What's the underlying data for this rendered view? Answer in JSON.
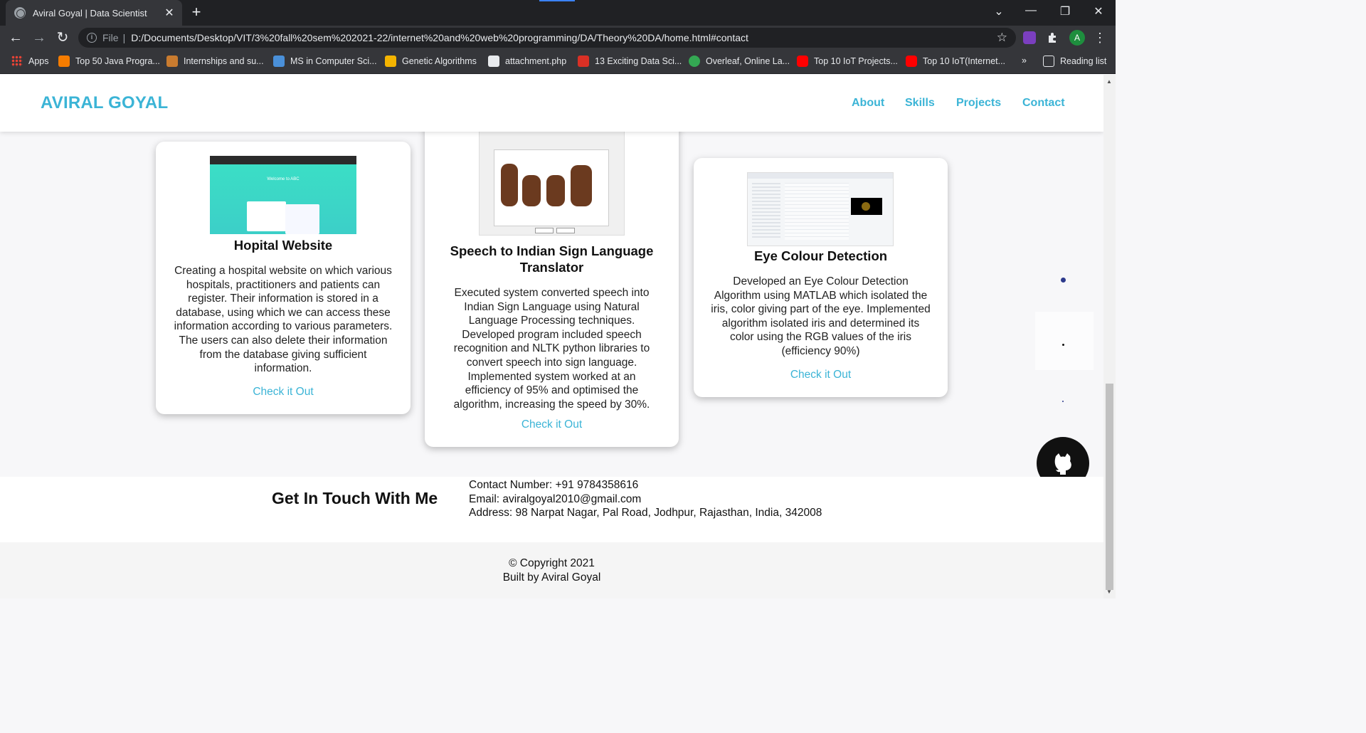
{
  "browser": {
    "tab_title": "Aviral Goyal | Data Scientist",
    "tab_close": "✕",
    "new_tab": "+",
    "url_scheme": "File",
    "url_separator": "|",
    "url": "D:/Documents/Desktop/VIT/3%20fall%20sem%202021-22/internet%20and%20web%20programming/DA/Theory%20DA/home.html#contact",
    "profile_initial": "A",
    "window_controls": {
      "tab_search": "⌄",
      "minimize": "—",
      "restore": "❐",
      "close": "✕"
    },
    "nav": {
      "back": "←",
      "forward": "→",
      "reload": "↻",
      "star": "☆",
      "menu": "⋮"
    }
  },
  "bookmarks": {
    "items": [
      {
        "label": "Apps",
        "icon": "apps-grid-icon",
        "color": "#ea4335"
      },
      {
        "label": "Top 50 Java Progra...",
        "icon": "blogger-icon",
        "color": "#f57c00"
      },
      {
        "label": "Internships and su...",
        "icon": "building-icon",
        "color": "#c97b2f"
      },
      {
        "label": "MS in Computer Sci...",
        "icon": "shield-icon",
        "color": "#4a90d9"
      },
      {
        "label": "Genetic Algorithms",
        "icon": "puzzle-icon",
        "color": "#f4b400"
      },
      {
        "label": "attachment.php",
        "icon": "vtop-icon",
        "color": "#e8eaed"
      },
      {
        "label": "13 Exciting Data Sci...",
        "icon": "analytics-icon",
        "color": "#d93025"
      },
      {
        "label": "Overleaf, Online La...",
        "icon": "leaf-icon",
        "color": "#34a853"
      },
      {
        "label": "Top 10 IoT Projects...",
        "icon": "youtube-icon",
        "color": "#ff0000"
      },
      {
        "label": "Top 10 IoT(Internet...",
        "icon": "youtube-icon",
        "color": "#ff0000"
      }
    ],
    "overflow": "»",
    "reading_list": "Reading list"
  },
  "site": {
    "brand": "AVIRAL GOYAL",
    "nav": [
      "About",
      "Skills",
      "Projects",
      "Contact"
    ],
    "accent_color": "#3bb4d6"
  },
  "projects": [
    {
      "title": "Hopital Website",
      "description": "Creating a hospital website on which various hospitals, practitioners and patients can register. Their information is stored in a database, using which we can access these information according to various parameters. The users can also delete their information from the database giving sufficient information.",
      "link": "Check it Out",
      "image_text": "Welcome to ABC"
    },
    {
      "title": "Speech to Indian Sign Language Translator",
      "description": "Executed system converted speech into Indian Sign Language using Natural Language Processing techniques. Developed program included speech recognition and NLTK python libraries to convert speech into sign language. Implemented system worked at an efficiency of 95% and optimised the algorithm, increasing the speed by 30%.",
      "link": "Check it Out"
    },
    {
      "title": "Eye Colour Detection",
      "description": "Developed an Eye Colour Detection Algorithm using MATLAB which isolated the iris, color giving part of the eye. Implemented algorithm isolated iris and determined its color using the RGB values of the iris (efficiency 90%)",
      "link": "Check it Out"
    }
  ],
  "contact": {
    "heading": "Get In Touch With Me",
    "phone": "Contact Number: +91 9784358616",
    "email": "Email: aviralgoyal2010@gmail.com",
    "address": "Address: 98 Narpat Nagar, Pal Road, Jodhpur, Rajasthan, India, 342008"
  },
  "footer": {
    "copyright": "© Copyright 2021",
    "built_by": "Built by Aviral Goyal"
  }
}
